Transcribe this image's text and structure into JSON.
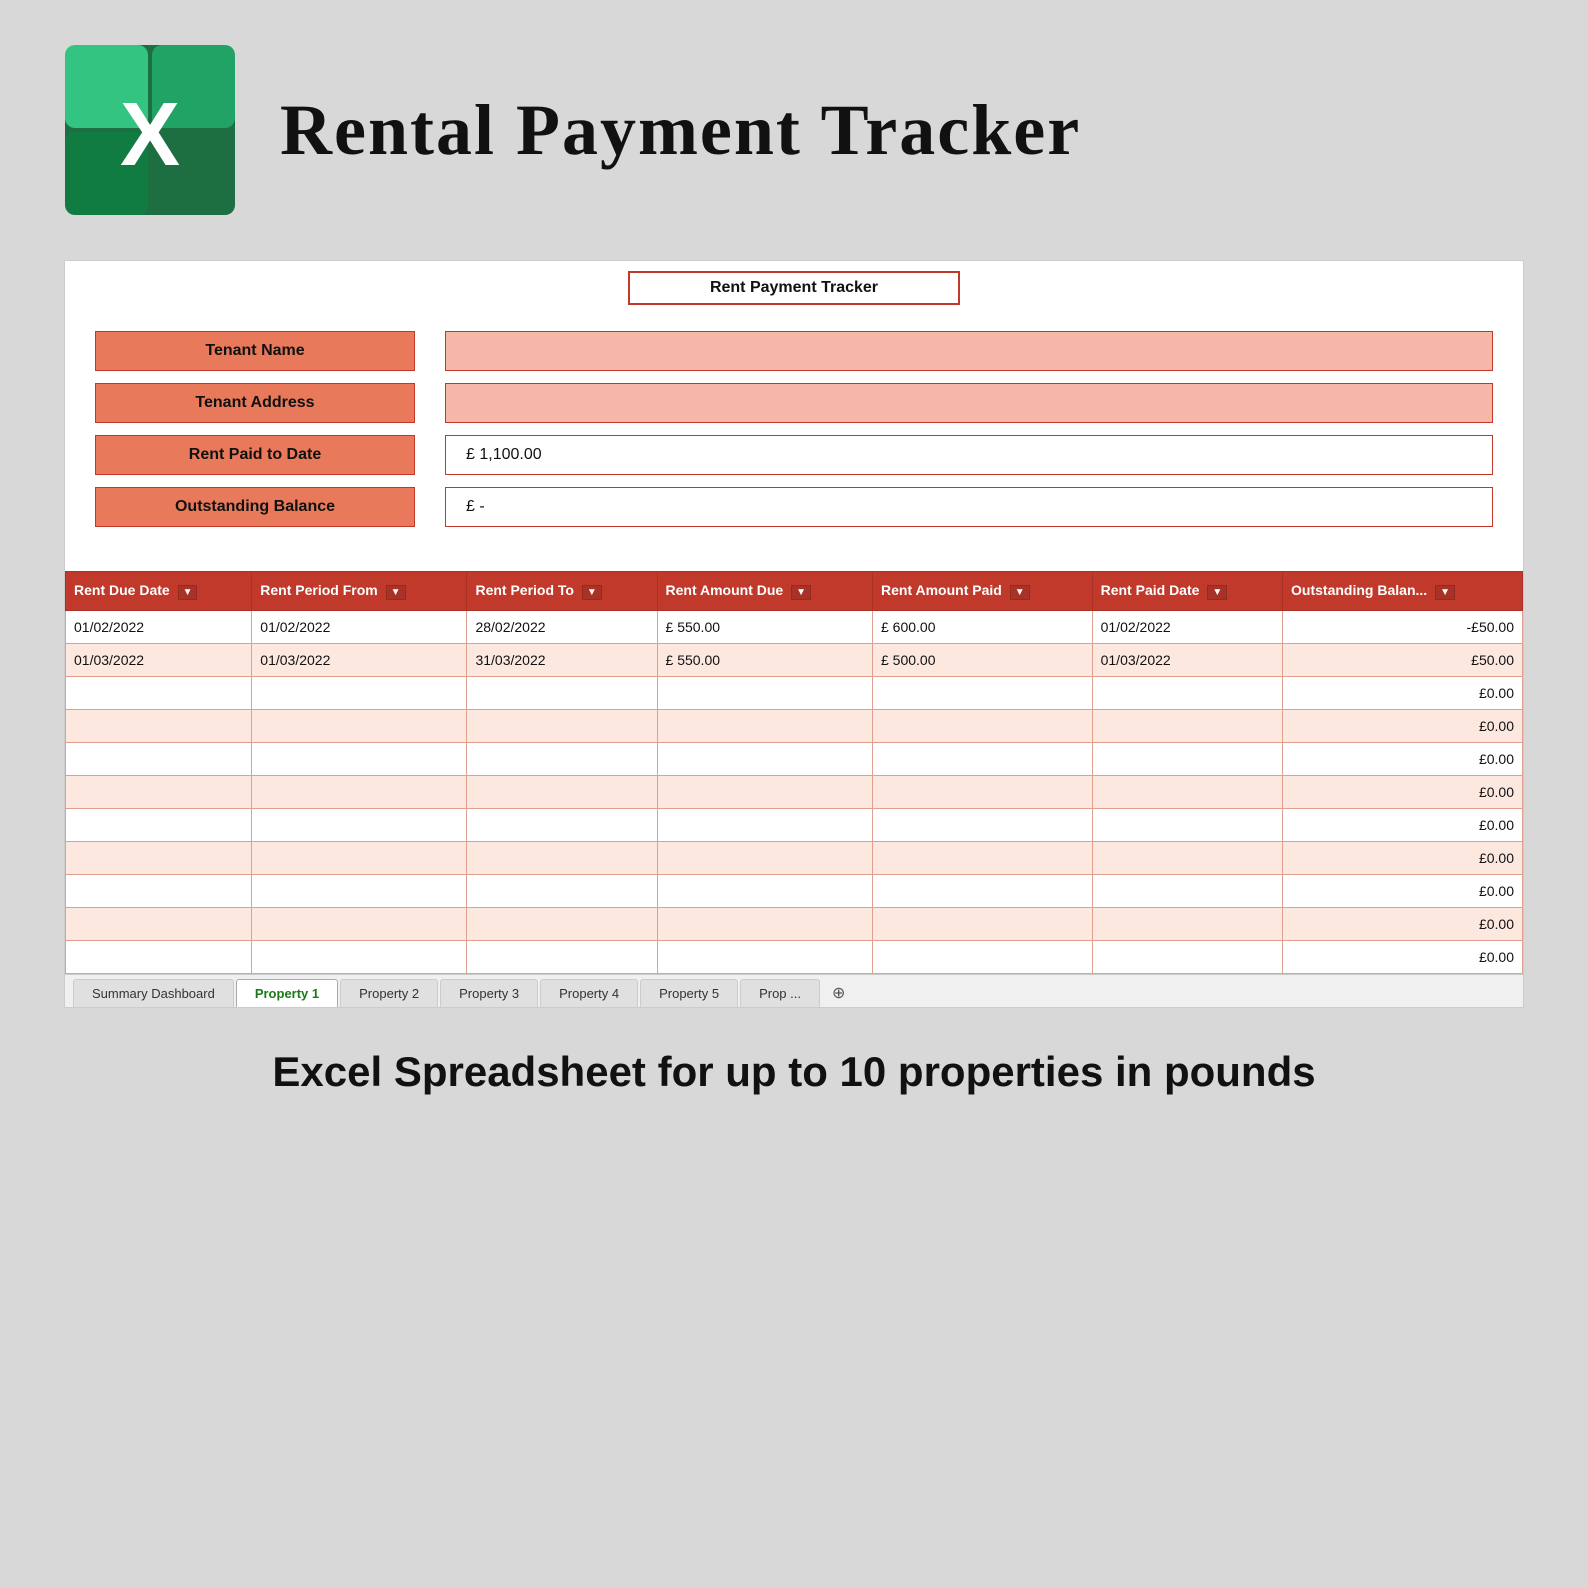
{
  "header": {
    "title": "Rental Payment Tracker",
    "excel_icon_letter": "X"
  },
  "spreadsheet": {
    "title": "Rent Payment Tracker",
    "info_fields": [
      {
        "label": "Tenant Name",
        "value": ""
      },
      {
        "label": "Tenant Address",
        "value": ""
      },
      {
        "label": "Rent Paid to Date",
        "value": "£     1,100.00"
      },
      {
        "label": "Outstanding Balance",
        "value": "£     -"
      }
    ],
    "table": {
      "columns": [
        "Rent Due Date",
        "Rent Period From",
        "Rent Period To",
        "Rent Amount Due",
        "Rent Amount Paid",
        "Rent Paid Date",
        "Outstanding Balan..."
      ],
      "rows": [
        {
          "due_date": "01/02/2022",
          "period_from": "01/02/2022",
          "period_to": "28/02/2022",
          "amount_due_currency": "£",
          "amount_due": "550.00",
          "amount_paid_currency": "£",
          "amount_paid": "600.00",
          "paid_date": "01/02/2022",
          "outstanding": "-£50.00"
        },
        {
          "due_date": "01/03/2022",
          "period_from": "01/03/2022",
          "period_to": "31/03/2022",
          "amount_due_currency": "£",
          "amount_due": "550.00",
          "amount_paid_currency": "£",
          "amount_paid": "500.00",
          "paid_date": "01/03/2022",
          "outstanding": "£50.00"
        },
        {
          "due_date": "",
          "period_from": "",
          "period_to": "",
          "amount_due_currency": "",
          "amount_due": "",
          "amount_paid_currency": "",
          "amount_paid": "",
          "paid_date": "",
          "outstanding": "£0.00"
        },
        {
          "due_date": "",
          "period_from": "",
          "period_to": "",
          "amount_due_currency": "",
          "amount_due": "",
          "amount_paid_currency": "",
          "amount_paid": "",
          "paid_date": "",
          "outstanding": "£0.00"
        },
        {
          "due_date": "",
          "period_from": "",
          "period_to": "",
          "amount_due_currency": "",
          "amount_due": "",
          "amount_paid_currency": "",
          "amount_paid": "",
          "paid_date": "",
          "outstanding": "£0.00"
        },
        {
          "due_date": "",
          "period_from": "",
          "period_to": "",
          "amount_due_currency": "",
          "amount_due": "",
          "amount_paid_currency": "",
          "amount_paid": "",
          "paid_date": "",
          "outstanding": "£0.00"
        },
        {
          "due_date": "",
          "period_from": "",
          "period_to": "",
          "amount_due_currency": "",
          "amount_due": "",
          "amount_paid_currency": "",
          "amount_paid": "",
          "paid_date": "",
          "outstanding": "£0.00"
        },
        {
          "due_date": "",
          "period_from": "",
          "period_to": "",
          "amount_due_currency": "",
          "amount_due": "",
          "amount_paid_currency": "",
          "amount_paid": "",
          "paid_date": "",
          "outstanding": "£0.00"
        },
        {
          "due_date": "",
          "period_from": "",
          "period_to": "",
          "amount_due_currency": "",
          "amount_due": "",
          "amount_paid_currency": "",
          "amount_paid": "",
          "paid_date": "",
          "outstanding": "£0.00"
        },
        {
          "due_date": "",
          "period_from": "",
          "period_to": "",
          "amount_due_currency": "",
          "amount_due": "",
          "amount_paid_currency": "",
          "amount_paid": "",
          "paid_date": "",
          "outstanding": "£0.00"
        },
        {
          "due_date": "",
          "period_from": "",
          "period_to": "",
          "amount_due_currency": "",
          "amount_due": "",
          "amount_paid_currency": "",
          "amount_paid": "",
          "paid_date": "",
          "outstanding": "£0.00"
        }
      ]
    },
    "tabs": [
      {
        "label": "Summary Dashboard",
        "active": false
      },
      {
        "label": "Property 1",
        "active": true
      },
      {
        "label": "Property 2",
        "active": false
      },
      {
        "label": "Property 3",
        "active": false
      },
      {
        "label": "Property 4",
        "active": false
      },
      {
        "label": "Property 5",
        "active": false
      },
      {
        "label": "Prop ...",
        "active": false
      }
    ]
  },
  "footer": {
    "text": "Excel Spreadsheet for up to 10 properties in pounds"
  },
  "colors": {
    "header_bg": "#c0392b",
    "row_bg": "#fde8e0",
    "label_bg": "#e8795a",
    "value_bg": "#f5b8a8"
  }
}
